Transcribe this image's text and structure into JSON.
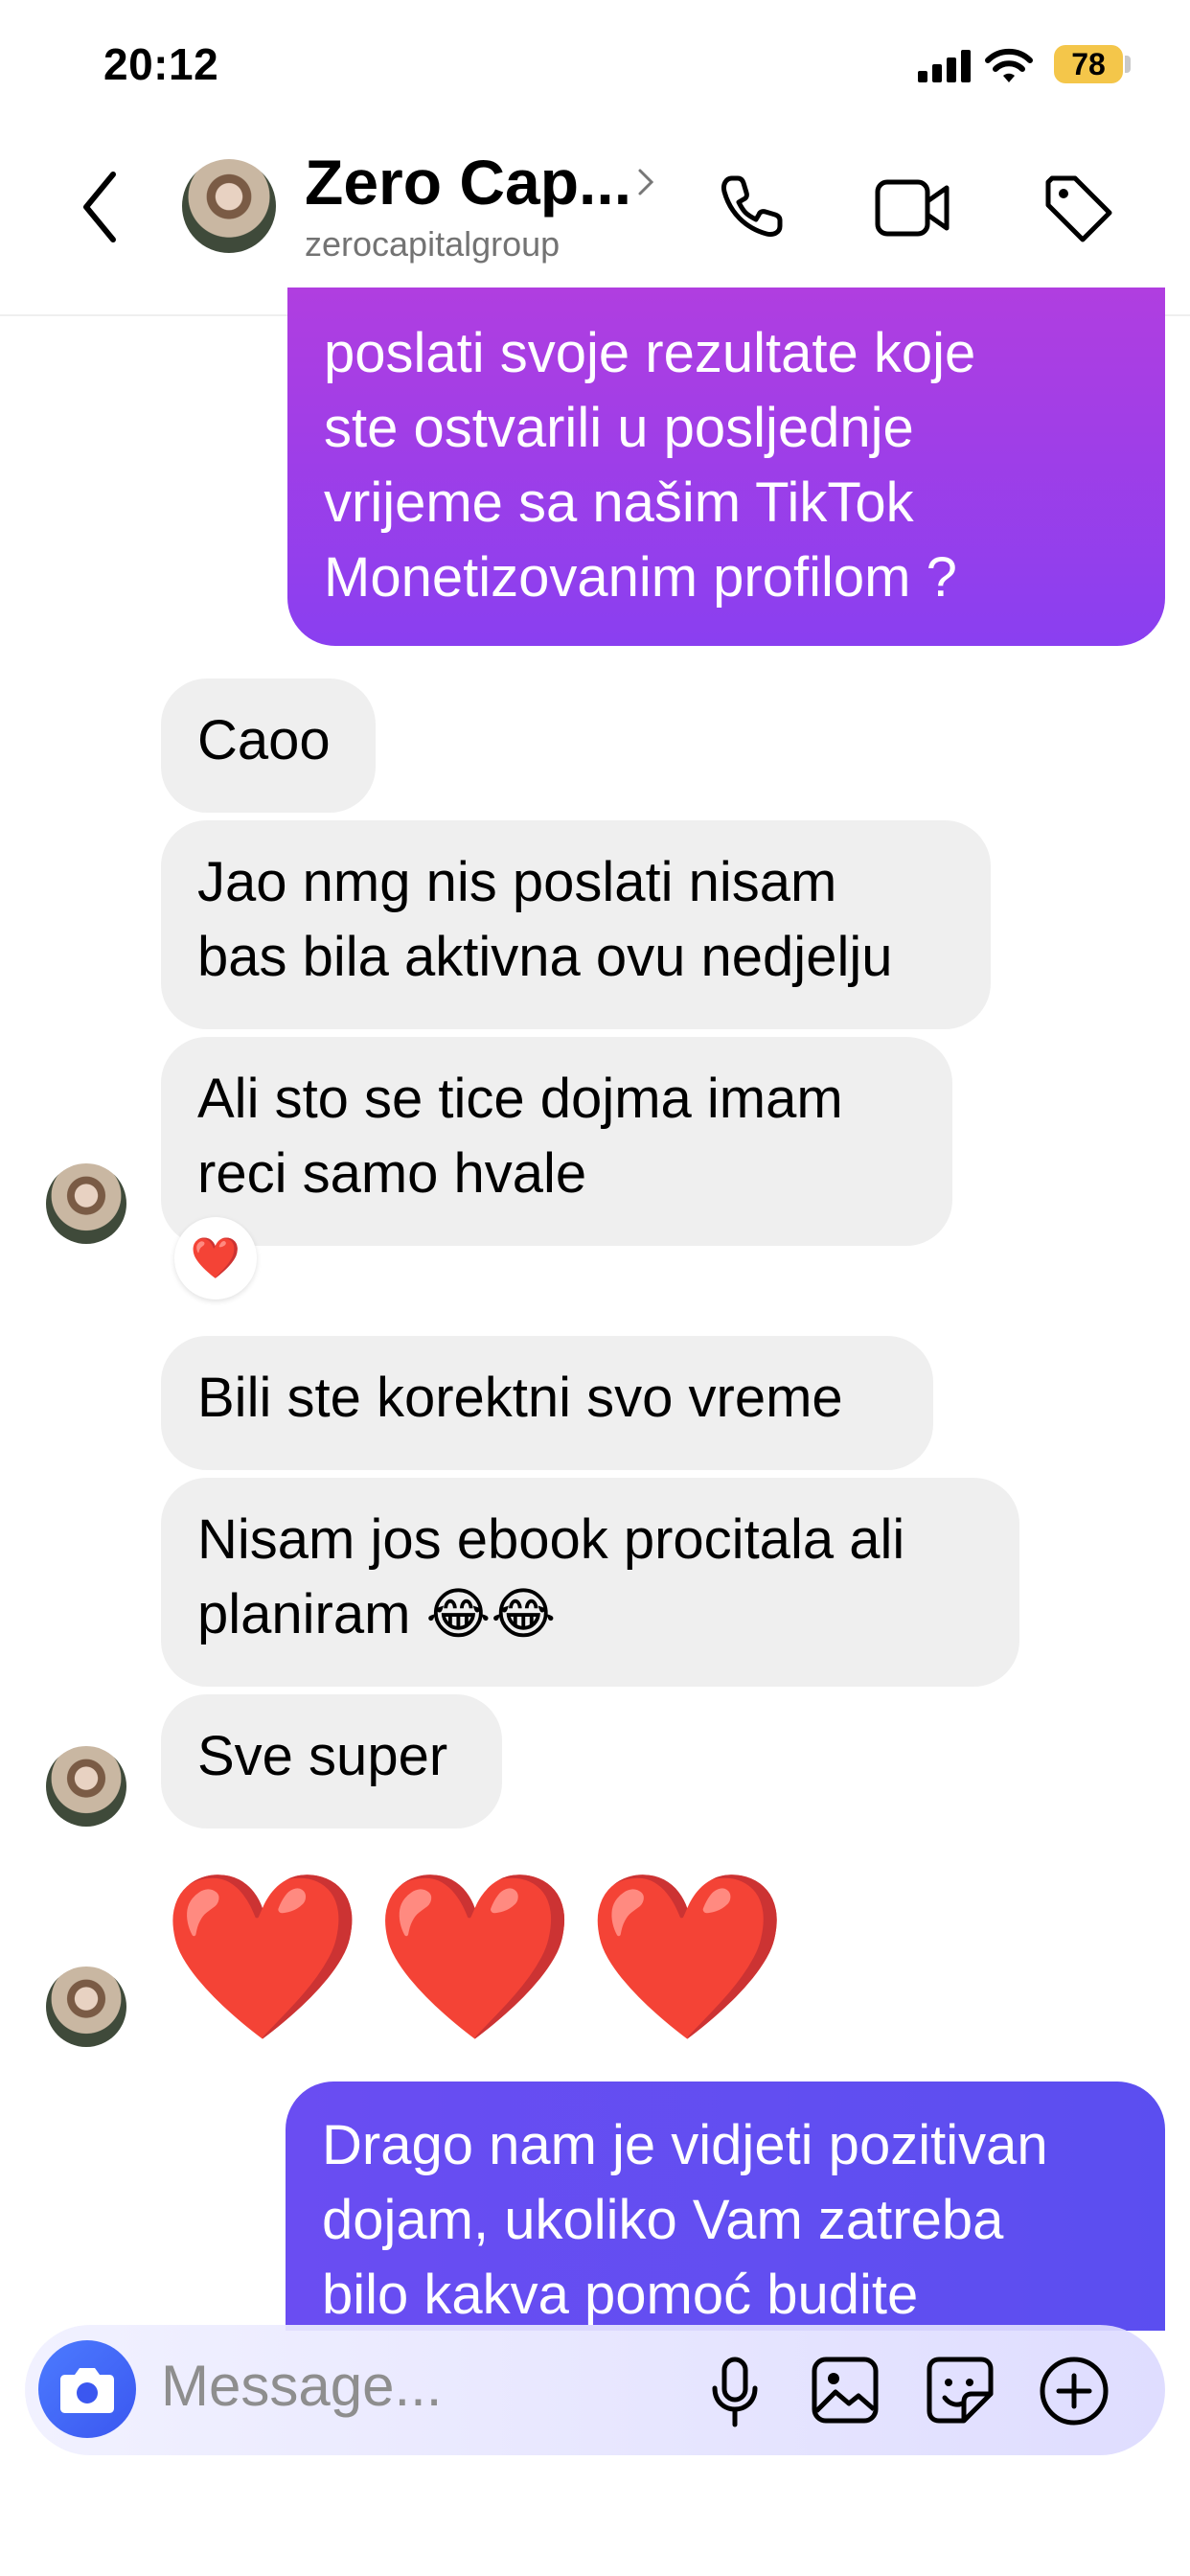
{
  "status_bar": {
    "time": "20:12",
    "battery": "78"
  },
  "header": {
    "name": "Zero Cap...",
    "username": "zerocapitalgroup"
  },
  "messages": {
    "out_1": "poslati svoje rezultate koje\nste ostvarili u posljednje\nvrijeme sa našim TikTok\nMonetizovanim profilom ?",
    "in_1": "Caoo",
    "in_2": "Jao nmg nis poslati nisam\nbas bila aktivna ovu nedjelju",
    "in_3": "Ali sto se tice dojma imam\nreci samo hvale",
    "in_3_reaction": "❤️",
    "in_4": "Bili ste korektni svo vreme",
    "in_5": "Nisam jos ebook procitala ali\nplaniram 😂😂",
    "in_6": "Sve super",
    "in_7": "❤️❤️❤️",
    "out_2": "Drago nam je vidjeti pozitivan\ndojam, ukoliko Vam zatreba\nbilo kakva pomoć budite"
  },
  "composer": {
    "placeholder": "Message..."
  },
  "colors": {
    "out_1_gradient": [
      "#b03ee0",
      "#7b3ff2"
    ],
    "out_2_gradient": [
      "#6a4df2",
      "#5b4ef0"
    ],
    "incoming_bubble": "#efefef",
    "camera_button": "#3b57f0"
  }
}
